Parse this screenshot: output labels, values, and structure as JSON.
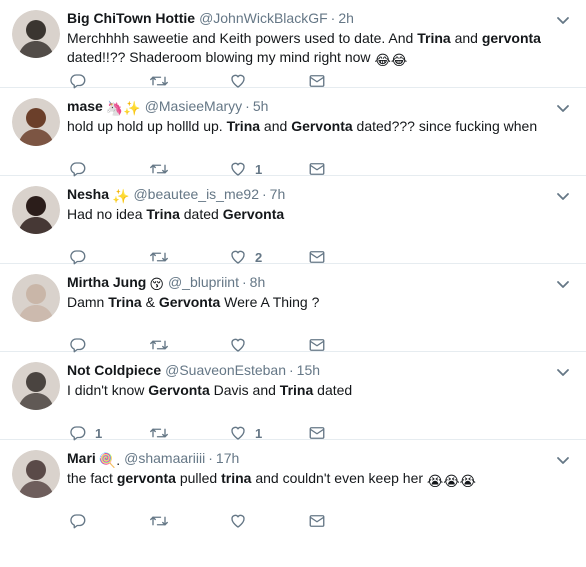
{
  "tweets": [
    {
      "name": "Big ChiTown Hottie",
      "handle": "@JohnWickBlackGF",
      "time": "2h",
      "text": [
        {
          "t": "Merchhhh saweetie and Keith powers used to date. And ",
          "b": false
        },
        {
          "t": "Trina",
          "b": true
        },
        {
          "t": " and ",
          "b": false
        },
        {
          "t": "gervonta",
          "b": true
        }
      ],
      "text2": [
        {
          "t": "dated!!?? Shaderoom blowing my mind right now",
          "b": false
        }
      ],
      "trailing_emoji": "😂😂",
      "reply_count": "",
      "retweet_count": "",
      "like_count": "",
      "avatar_color": "#3a3530"
    },
    {
      "name": "mase",
      "name_emoji": "🦄✨",
      "handle": "@MasieeMaryy",
      "time": "5h",
      "text": [
        {
          "t": "hold up hold up hollld up. ",
          "b": false
        },
        {
          "t": "Trina",
          "b": true
        },
        {
          "t": " and ",
          "b": false
        },
        {
          "t": "Gervonta",
          "b": true
        },
        {
          "t": " dated??? since fucking when",
          "b": false
        }
      ],
      "reply_count": "",
      "retweet_count": "",
      "like_count": "1",
      "avatar_color": "#6b3f2a"
    },
    {
      "name": "Nesha",
      "name_emoji": "✨",
      "handle": "@beautee_is_me92",
      "time": "7h",
      "text": [
        {
          "t": "Had no idea ",
          "b": false
        },
        {
          "t": "Trina",
          "b": true
        },
        {
          "t": " dated ",
          "b": false
        },
        {
          "t": "Gervonta",
          "b": true
        }
      ],
      "reply_count": "",
      "retweet_count": "",
      "like_count": "2",
      "avatar_color": "#2b1d1a"
    },
    {
      "name": "Mirtha Jung",
      "name_emoji": "😚",
      "handle": "@_blupriint",
      "time": "8h",
      "text": [
        {
          "t": "Damn ",
          "b": false
        },
        {
          "t": "Trina",
          "b": true
        },
        {
          "t": " & ",
          "b": false
        },
        {
          "t": "Gervonta",
          "b": true
        },
        {
          "t": " Were A Thing ?",
          "b": false
        }
      ],
      "reply_count": "",
      "retweet_count": "",
      "like_count": "",
      "avatar_color": "#c9b6a8"
    },
    {
      "name": "Not Coldpiece",
      "handle": "@SuaveonEsteban",
      "time": "15h",
      "text": [
        {
          "t": "I didn't know ",
          "b": false
        },
        {
          "t": "Gervonta",
          "b": true
        },
        {
          "t": " Davis and ",
          "b": false
        },
        {
          "t": "Trina",
          "b": true
        },
        {
          "t": " dated",
          "b": false
        }
      ],
      "reply_count": "1",
      "retweet_count": "",
      "like_count": "1",
      "avatar_color": "#4a4440"
    },
    {
      "name": "Mari",
      "name_emoji": "🍭.",
      "handle": "@shamaariiii",
      "time": "17h",
      "text": [
        {
          "t": "the fact ",
          "b": false
        },
        {
          "t": "gervonta",
          "b": true
        },
        {
          "t": " pulled ",
          "b": false
        },
        {
          "t": "trina",
          "b": true
        },
        {
          "t": " and couldn't even keep her ",
          "b": false
        }
      ],
      "trailing_emoji": "😭😭😭",
      "reply_count": "",
      "retweet_count": "",
      "like_count": "",
      "avatar_color": "#5a4a48"
    }
  ],
  "colors": {
    "icon": "#657786",
    "border": "#e6ecf0",
    "name": "#14171a"
  }
}
